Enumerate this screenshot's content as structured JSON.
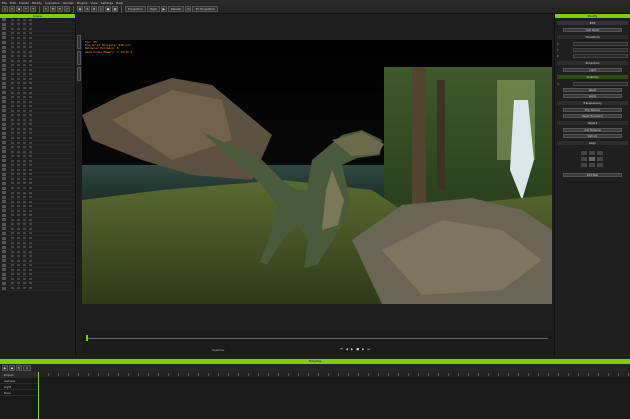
{
  "menu": [
    "File",
    "Edit",
    "Create",
    "Modify",
    "Animation",
    "Render",
    "Plugins",
    "View",
    "Settings",
    "Help"
  ],
  "toolbar": {
    "mode_select": "Projection",
    "quality_select": "High",
    "camera_select": "Preview",
    "render_label": "Render",
    "tv_label": "TV Projection"
  },
  "left_panel": {
    "title": "Scene",
    "row_count": 60
  },
  "viewport": {
    "info_lines": [
      "Fps: 30",
      "Projected Polygons: 848,172",
      "Rendered Polygons: 0",
      "Used Video Memory: 1.12/15.9"
    ]
  },
  "right_panel": {
    "title": "Modify",
    "tab_label": "Edit",
    "sections": [
      "Transform",
      "Projection",
      "Visibility",
      "Transparency",
      "Object",
      "Align"
    ],
    "buttons": [
      "Sub Panel",
      "Light",
      "Reset",
      "Apply",
      "Flip Texture",
      "Reset Transform",
      "Add Material",
      "Deform",
      "Edit Map"
    ]
  },
  "timeline": {
    "title": "Timeline",
    "current_frame": "0",
    "tracks": [
      "Project",
      "Camera",
      "Light",
      "Dino"
    ]
  },
  "playback": {
    "label": "Realtime"
  }
}
